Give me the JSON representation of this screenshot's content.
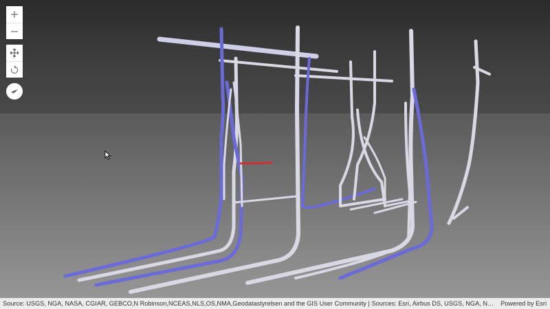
{
  "view": {
    "type": "3d-scene",
    "pipe_colors": {
      "white": "#d9d9e6",
      "blue": "#6a6ad8",
      "red": "#d03030"
    },
    "ground_color": "#8a8a8a",
    "sky_color": "#3a3a3a"
  },
  "controls": {
    "zoom_in": {
      "icon": "plus-icon"
    },
    "zoom_out": {
      "icon": "minus-icon"
    },
    "pan": {
      "icon": "pan-arrows-icon"
    },
    "rotate": {
      "icon": "rotate-icon"
    },
    "compass": {
      "icon": "compass-icon"
    }
  },
  "attribution": {
    "text": "Source: USGS, NGA, NASA, CGIAR, GEBCO,N Robinson,NCEAS,NLS,OS,NMA,Geodatastyrelsen and the GIS User Community | Sources: Esri, Airbus DS, USGS, NGA, NASA, CGIAR, N Robins…",
    "powered_by": "Powered by Esri"
  }
}
